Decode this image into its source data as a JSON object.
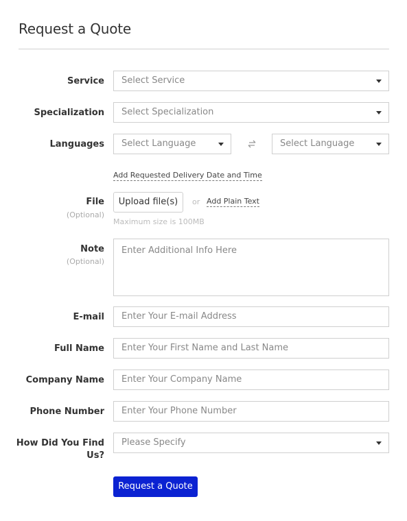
{
  "header": {
    "title": "Request a Quote"
  },
  "form": {
    "service": {
      "label": "Service",
      "placeholder": "Select Service"
    },
    "specialization": {
      "label": "Specialization",
      "placeholder": "Select Specialization"
    },
    "languages": {
      "label": "Languages",
      "source_placeholder": "Select Language",
      "target_placeholder": "Select Language",
      "swap_icon": "swap-arrows-icon"
    },
    "delivery_link": "Add Requested Delivery Date and Time",
    "file": {
      "label": "File",
      "optional": "(Optional)",
      "upload_label": "Upload file(s)",
      "or": "or",
      "plain_text_link": "Add Plain Text",
      "hint": "Maximum size is 100MB"
    },
    "note": {
      "label": "Note",
      "optional": "(Optional)",
      "placeholder": "Enter Additional Info Here"
    },
    "email": {
      "label": "E-mail",
      "placeholder": "Enter Your E-mail Address"
    },
    "full_name": {
      "label": "Full Name",
      "placeholder": "Enter Your First Name and Last Name"
    },
    "company": {
      "label": "Company Name",
      "placeholder": "Enter Your Company Name"
    },
    "phone": {
      "label": "Phone Number",
      "placeholder": "Enter Your Phone Number"
    },
    "source": {
      "label": "How Did You Find Us?",
      "placeholder": "Please Specify"
    },
    "submit_label": "Request a Quote"
  },
  "colors": {
    "primary": "#0b22d2",
    "border": "#cfcfcf",
    "placeholder": "#888888"
  }
}
